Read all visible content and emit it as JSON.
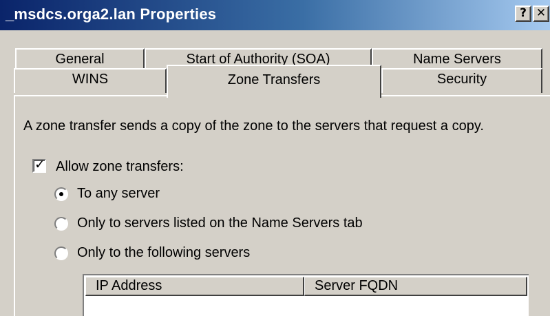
{
  "window": {
    "title": "_msdcs.orga2.lan Properties",
    "help_button": "?",
    "close_button": "✕"
  },
  "tabs": {
    "row_back": [
      "General",
      "Start of Authority (SOA)",
      "Name Servers"
    ],
    "row_front": [
      "WINS",
      "Zone Transfers",
      "Security"
    ],
    "active": "Zone Transfers"
  },
  "zone_transfers": {
    "description": "A zone transfer sends a copy of the zone to the servers that request a copy.",
    "allow_label": "Allow zone transfers:",
    "allow_checked": true,
    "check_glyph": "✓",
    "options": [
      {
        "label": "To any server",
        "selected": true
      },
      {
        "label": "Only to servers listed on the Name Servers tab",
        "selected": false
      },
      {
        "label": "Only to the following servers",
        "selected": false
      }
    ],
    "servers_table": {
      "columns": [
        "IP Address",
        "Server FQDN"
      ],
      "rows": []
    }
  }
}
